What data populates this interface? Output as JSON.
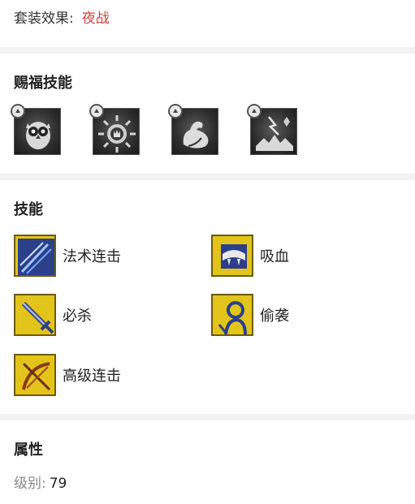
{
  "set_effect": {
    "label": "套装效果:",
    "value": "夜战"
  },
  "blessing": {
    "title": "赐福技能",
    "icons": [
      "owl-icon",
      "sunburst-icon",
      "flex-arm-icon",
      "lightning-ground-icon"
    ]
  },
  "skills": {
    "title": "技能",
    "items": [
      {
        "label": "法术连击",
        "icon": "spell-strike-icon"
      },
      {
        "label": "吸血",
        "icon": "vampire-icon"
      },
      {
        "label": "必杀",
        "icon": "sword-icon"
      },
      {
        "label": "偷袭",
        "icon": "sneak-attack-icon"
      },
      {
        "label": "高级连击",
        "icon": "advanced-combo-icon"
      }
    ]
  },
  "attributes": {
    "title": "属性",
    "level_label": "级别:",
    "level_value": "79"
  }
}
